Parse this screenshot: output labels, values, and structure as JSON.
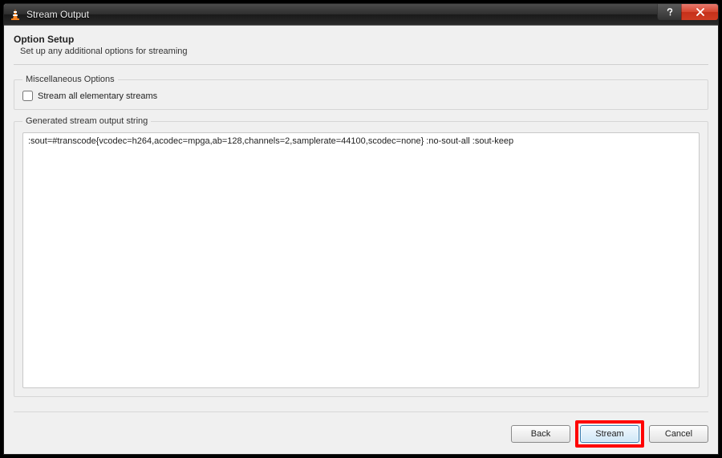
{
  "window": {
    "title": "Stream Output"
  },
  "header": {
    "title": "Option Setup",
    "subtitle": "Set up any additional options for streaming"
  },
  "misc": {
    "legend": "Miscellaneous Options",
    "stream_all_label": "Stream all elementary streams",
    "stream_all_checked": false
  },
  "output": {
    "legend": "Generated stream output string",
    "value": ":sout=#transcode{vcodec=h264,acodec=mpga,ab=128,channels=2,samplerate=44100,scodec=none} :no-sout-all :sout-keep"
  },
  "buttons": {
    "back": "Back",
    "stream": "Stream",
    "cancel": "Cancel"
  }
}
